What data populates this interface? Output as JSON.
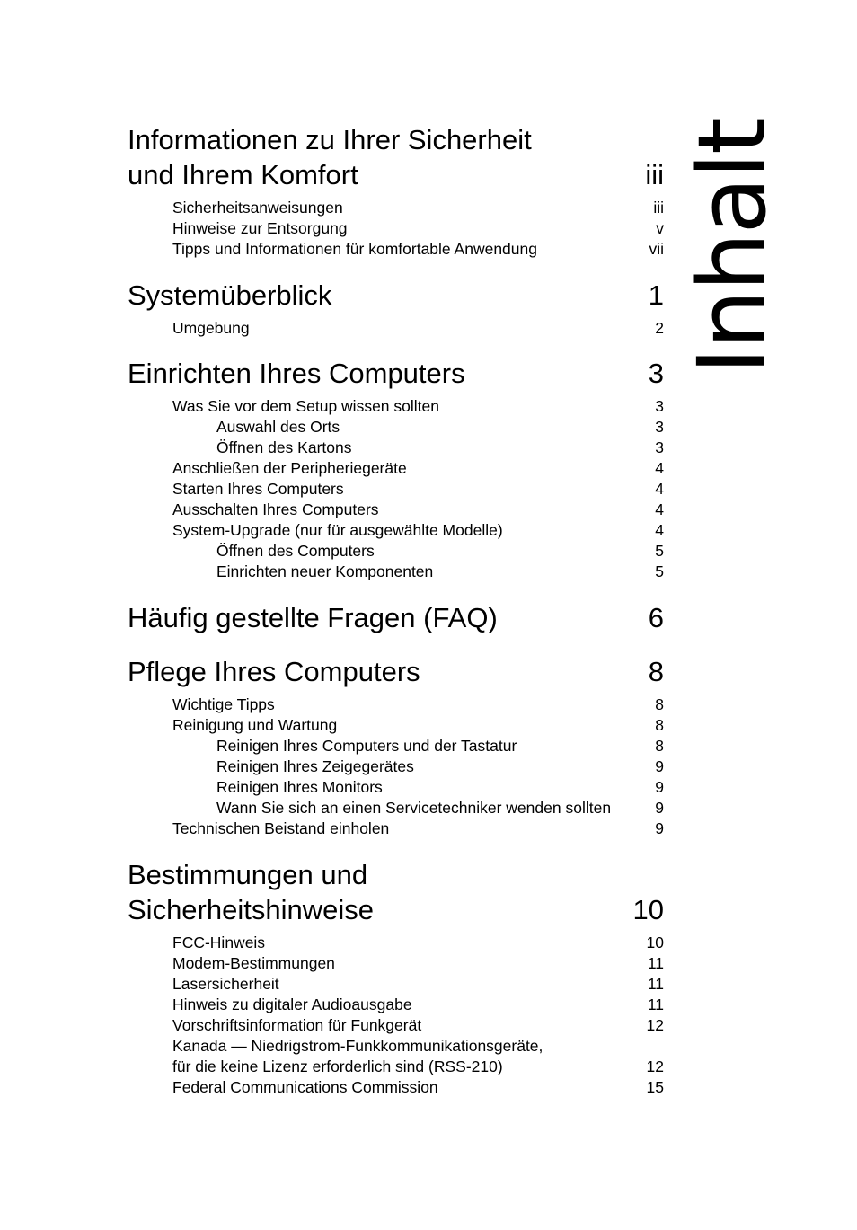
{
  "side_title": "Inhalt",
  "chapters": [
    {
      "title_lines": [
        "Informationen zu Ihrer Sicherheit",
        "und Ihrem Komfort"
      ],
      "page": "iii",
      "entries": [
        {
          "label": "Sicherheitsanweisungen",
          "page": "iii",
          "level": 1
        },
        {
          "label": "Hinweise zur Entsorgung",
          "page": "v",
          "level": 1
        },
        {
          "label": "Tipps und Informationen für komfortable Anwendung",
          "page": "vii",
          "level": 1
        }
      ]
    },
    {
      "title_lines": [
        "Systemüberblick"
      ],
      "page": "1",
      "entries": [
        {
          "label": "Umgebung",
          "page": "2",
          "level": 1
        }
      ]
    },
    {
      "title_lines": [
        "Einrichten Ihres Computers"
      ],
      "page": "3",
      "entries": [
        {
          "label": "Was Sie vor dem Setup wissen sollten",
          "page": "3",
          "level": 1
        },
        {
          "label": "Auswahl des Orts",
          "page": "3",
          "level": 2
        },
        {
          "label": "Öffnen des Kartons",
          "page": "3",
          "level": 2
        },
        {
          "label": "Anschließen der Peripheriegeräte",
          "page": "4",
          "level": 1
        },
        {
          "label": "Starten Ihres Computers",
          "page": "4",
          "level": 1
        },
        {
          "label": "Ausschalten Ihres Computers",
          "page": "4",
          "level": 1
        },
        {
          "label": "System-Upgrade (nur für ausgewählte Modelle)",
          "page": "4",
          "level": 1
        },
        {
          "label": "Öffnen des Computers",
          "page": "5",
          "level": 2
        },
        {
          "label": "Einrichten neuer Komponenten",
          "page": "5",
          "level": 2
        }
      ]
    },
    {
      "title_lines": [
        "Häufig gestellte Fragen (FAQ)"
      ],
      "page": "6",
      "entries": []
    },
    {
      "title_lines": [
        "Pflege Ihres Computers"
      ],
      "page": "8",
      "entries": [
        {
          "label": "Wichtige Tipps",
          "page": "8",
          "level": 1
        },
        {
          "label": "Reinigung und Wartung",
          "page": "8",
          "level": 1
        },
        {
          "label": "Reinigen Ihres Computers und der Tastatur",
          "page": "8",
          "level": 2
        },
        {
          "label": "Reinigen Ihres Zeigegerätes",
          "page": "9",
          "level": 2
        },
        {
          "label": "Reinigen Ihres Monitors",
          "page": "9",
          "level": 2
        },
        {
          "label": "Wann Sie sich an einen Servicetechniker wenden sollten",
          "page": "9",
          "level": 2
        },
        {
          "label": "Technischen Beistand einholen",
          "page": "9",
          "level": 1
        }
      ]
    },
    {
      "title_lines": [
        "Bestimmungen und",
        "Sicherheitshinweise"
      ],
      "page": "10",
      "entries": [
        {
          "label": "FCC-Hinweis",
          "page": "10",
          "level": 1
        },
        {
          "label": "Modem-Bestimmungen",
          "page": "11",
          "level": 1
        },
        {
          "label": "Lasersicherheit",
          "page": "11",
          "level": 1
        },
        {
          "label": "Hinweis zu digitaler Audioausgabe",
          "page": "11",
          "level": 1
        },
        {
          "label": "Vorschriftsinformation für Funkgerät",
          "page": "12",
          "level": 1
        },
        {
          "label": "Kanada — Niedrigstrom-Funkkommunikationsgeräte,",
          "page": "",
          "level": 1
        },
        {
          "label": "für die keine Lizenz erforderlich sind (RSS-210)",
          "page": "12",
          "level": 1
        },
        {
          "label": "Federal Communications Commission",
          "page": "15",
          "level": 1
        }
      ]
    }
  ]
}
